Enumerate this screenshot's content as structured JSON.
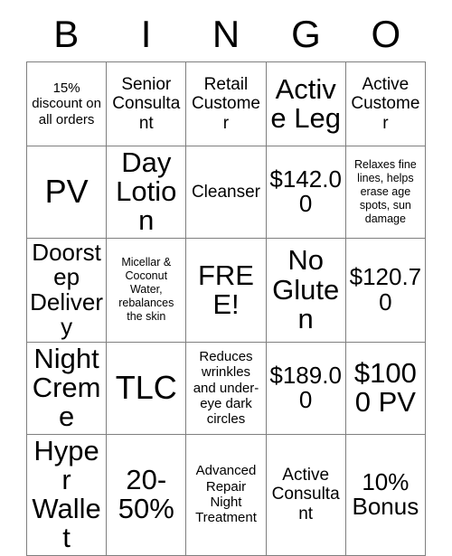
{
  "card": {
    "title": "Bingo Card",
    "grid_line_color": "#7f7f7f",
    "text_color": "#000000",
    "background_color": "#ffffff",
    "header": {
      "letters": [
        "B",
        "I",
        "N",
        "G",
        "O"
      ]
    },
    "rows": [
      {
        "cells": [
          {
            "text": "15% discount on all orders",
            "size": "sm"
          },
          {
            "text": "Senior Consultant",
            "size": "md"
          },
          {
            "text": "Retail Customer",
            "size": "md"
          },
          {
            "text": "Active Leg",
            "size": "xl"
          },
          {
            "text": "Active Customer",
            "size": "md"
          }
        ]
      },
      {
        "cells": [
          {
            "text": "PV",
            "size": "xxl"
          },
          {
            "text": "Day Lotion",
            "size": "xl"
          },
          {
            "text": "Cleanser",
            "size": "md"
          },
          {
            "text": "$142.00",
            "size": "lg"
          },
          {
            "text": "Relaxes fine lines, helps erase age spots, sun damage",
            "size": "xs"
          }
        ]
      },
      {
        "cells": [
          {
            "text": "Doorstep Delivery",
            "size": "lg"
          },
          {
            "text": "Micellar & Coconut Water, rebalances the skin",
            "size": "xs"
          },
          {
            "text": "FREE!",
            "size": "xl"
          },
          {
            "text": "No Gluten",
            "size": "xl"
          },
          {
            "text": "$120.70",
            "size": "lg"
          }
        ]
      },
      {
        "cells": [
          {
            "text": "Night Creme",
            "size": "xl"
          },
          {
            "text": "TLC",
            "size": "xxl"
          },
          {
            "text": "Reduces wrinkles and under-eye dark circles",
            "size": "sm"
          },
          {
            "text": "$189.00",
            "size": "lg"
          },
          {
            "text": "$1000 PV",
            "size": "xl"
          }
        ]
      },
      {
        "cells": [
          {
            "text": "Hyper Wallet",
            "size": "xl"
          },
          {
            "text": "20-50%",
            "size": "xl"
          },
          {
            "text": "Advanced Repair Night Treatment",
            "size": "sm"
          },
          {
            "text": "Active Consultant",
            "size": "md"
          },
          {
            "text": "10% Bonus",
            "size": "lg"
          }
        ]
      }
    ]
  }
}
